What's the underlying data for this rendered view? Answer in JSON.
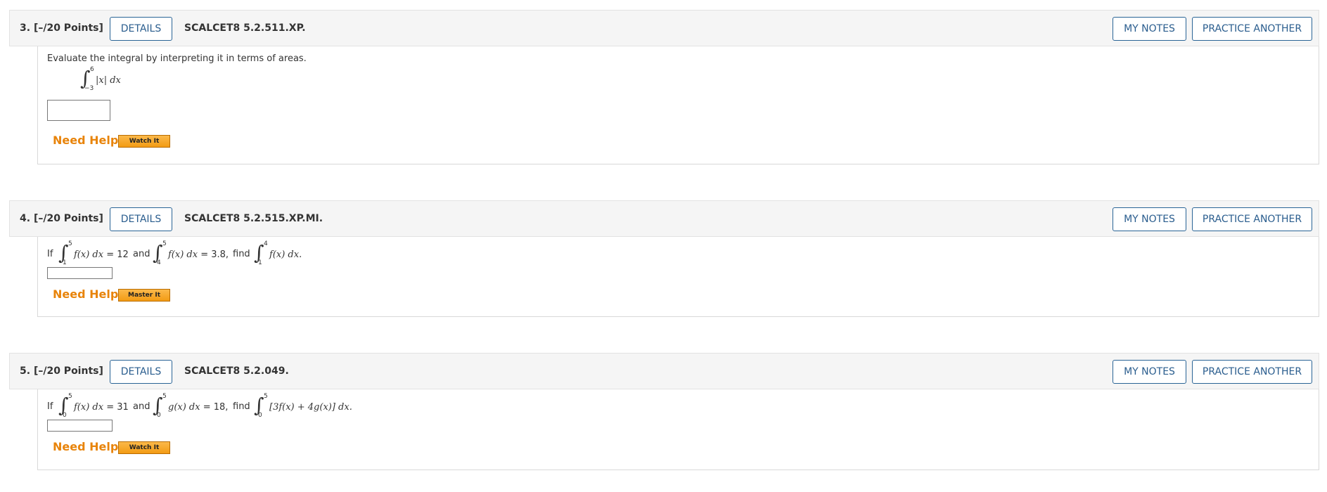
{
  "buttons": {
    "details": "DETAILS",
    "my_notes": "MY NOTES",
    "practice_another": "PRACTICE ANOTHER"
  },
  "need_help": "Need Help?",
  "questions": [
    {
      "number": "3.",
      "points": "[–/20 Points]",
      "code": "SCALCET8 5.2.511.XP.",
      "prompt": "Evaluate the integral by interpreting it in terms of areas.",
      "integral": {
        "upper": "6",
        "lower": "−3",
        "integrand": "|x|",
        "dx": "dx"
      },
      "answer": "",
      "help_button": "Watch It"
    },
    {
      "number": "4.",
      "points": "[–/20 Points]",
      "code": "SCALCET8 5.2.515.XP.MI.",
      "if": "If",
      "int1": {
        "upper": "5",
        "lower": "1",
        "expr": "f(x) dx",
        "value": " = 12"
      },
      "and": "and",
      "int2": {
        "upper": "5",
        "lower": "4",
        "expr": "f(x) dx",
        "value": " = 3.8,"
      },
      "find": "find",
      "int3": {
        "upper": "4",
        "lower": "1",
        "expr": "f(x) dx."
      },
      "answer": "",
      "help_button": "Master It"
    },
    {
      "number": "5.",
      "points": "[–/20 Points]",
      "code": "SCALCET8 5.2.049.",
      "if": "If",
      "int1": {
        "upper": "5",
        "lower": "0",
        "expr": "f(x) dx",
        "value": " = 31"
      },
      "and": "and",
      "int2": {
        "upper": "5",
        "lower": "0",
        "expr": "g(x) dx",
        "value": " = 18,"
      },
      "find": "find",
      "int3": {
        "upper": "5",
        "lower": "0",
        "expr": "[3f(x) + 4g(x)] dx."
      },
      "answer": "",
      "help_button": "Watch It"
    }
  ]
}
